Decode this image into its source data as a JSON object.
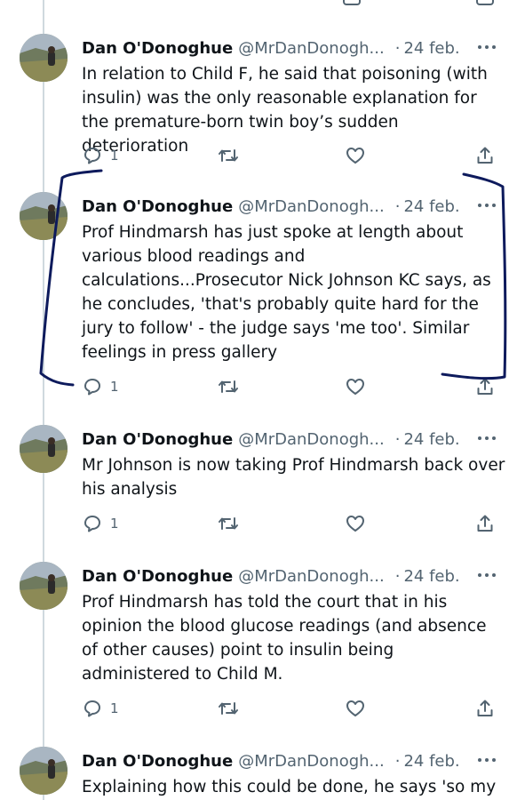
{
  "tweets": [
    {
      "author": "Dan O'Donoghue",
      "handle": "@MrDanDonogh...",
      "date": "24 feb.",
      "text": "In relation to Child F, he said that poisoning (with insulin) was the only reasonable explanation for the premature-born twin boy’s sudden deterioration",
      "replies": "1"
    },
    {
      "author": "Dan O'Donoghue",
      "handle": "@MrDanDonogh...",
      "date": "24 feb.",
      "text": "Prof Hindmarsh has just spoke at length about various blood readings and calculations...Prosecutor Nick Johnson KC says, as he concludes, 'that's probably quite hard for the jury to follow' - the judge says 'me too'. Similar feelings in press gallery",
      "replies": "1"
    },
    {
      "author": "Dan O'Donoghue",
      "handle": "@MrDanDonogh...",
      "date": "24 feb.",
      "text": "Mr Johnson is now taking Prof Hindmarsh back over his analysis",
      "replies": "1"
    },
    {
      "author": "Dan O'Donoghue",
      "handle": "@MrDanDonogh...",
      "date": "24 feb.",
      "text": "Prof Hindmarsh has told the court that in his opinion the blood glucose readings (and absence of other causes) point to insulin being administered to Child M.",
      "replies": "1"
    },
    {
      "author": "Dan O'Donoghue",
      "handle": "@MrDanDonogh...",
      "date": "24 feb.",
      "text": "Explaining how this could be done, he says 'so my",
      "replies": ""
    }
  ],
  "separator": "·",
  "colors": {
    "text": "#0f1419",
    "muted": "#536471",
    "thread": "#cfd9de",
    "annotation": "#0d1a5c"
  },
  "icons": [
    "reply-icon",
    "retweet-icon",
    "like-icon",
    "share-icon",
    "more-icon"
  ]
}
